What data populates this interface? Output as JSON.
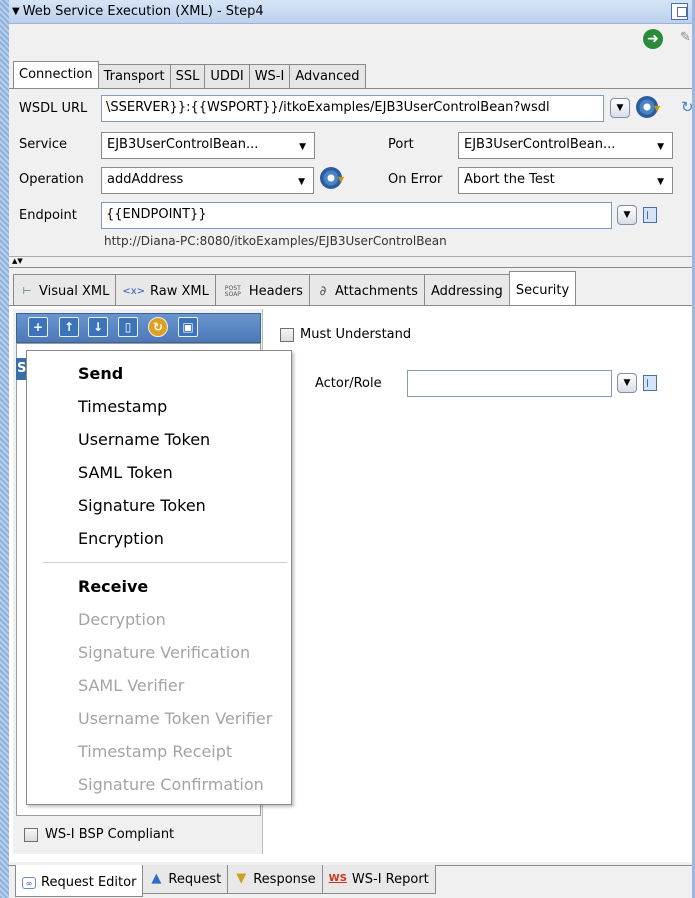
{
  "window": {
    "title": "Web Service Execution (XML) - Step4"
  },
  "top_tabs": [
    "Connection",
    "Transport",
    "SSL",
    "UDDI",
    "WS-I",
    "Advanced"
  ],
  "connection": {
    "wsdl_label": "WSDL URL",
    "wsdl_value": "\\SSERVER}}:{{WSPORT}}/itkoExamples/EJB3UserControlBean?wsdl",
    "service_label": "Service",
    "service_value": "EJB3UserControlBean...",
    "port_label": "Port",
    "port_value": "EJB3UserControlBean...",
    "operation_label": "Operation",
    "operation_value": "addAddress",
    "onerror_label": "On Error",
    "onerror_value": "Abort the Test",
    "endpoint_label": "Endpoint",
    "endpoint_value": "{{ENDPOINT}}",
    "endpoint_resolved": "http://Diana-PC:8080/itkoExamples/EJB3UserControlBean"
  },
  "request_tabs": {
    "visual_xml": "Visual XML",
    "raw_xml": "Raw XML",
    "headers": "Headers",
    "attachments": "Attachments",
    "addressing": "Addressing",
    "security": "Security",
    "raw_xml_icon_text": "<x>",
    "headers_icon_text": "POST SOAP"
  },
  "security": {
    "list_selected_prefix": "S",
    "must_understand_label": "Must Understand",
    "actor_role_label": "Actor/Role",
    "actor_role_value": "",
    "wsi_bsp_label": "WS-I BSP Compliant"
  },
  "menu": {
    "send_header": "Send",
    "send_items": [
      "Timestamp",
      "Username Token",
      "SAML Token",
      "Signature Token",
      "Encryption"
    ],
    "receive_header": "Receive",
    "receive_items": [
      "Decryption",
      "Signature Verification",
      "SAML Verifier",
      "Username Token Verifier",
      "Timestamp Receipt",
      "Signature Confirmation"
    ]
  },
  "bottom_tabs": {
    "request_editor": "Request Editor",
    "request": "Request",
    "response": "Response",
    "wsi_report": "WS-I Report",
    "wsi_icon_text": "WS"
  },
  "icons": [
    "maximize-icon",
    "go-icon",
    "wrench-icon",
    "gear-icon",
    "copy-icon",
    "add-icon",
    "move-up-icon",
    "move-down-icon",
    "delete-icon",
    "refresh-icon",
    "save-icon"
  ]
}
